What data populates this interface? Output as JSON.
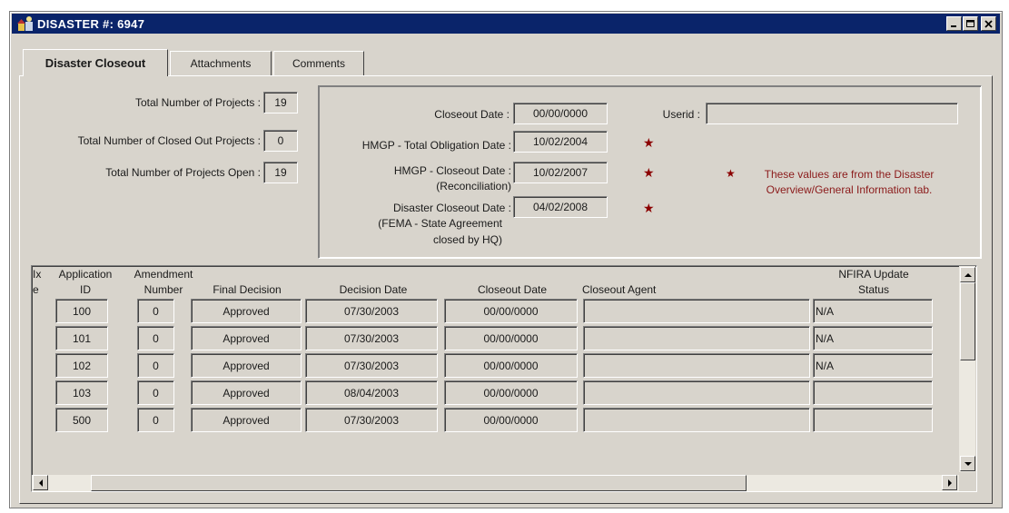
{
  "window": {
    "title": "DISASTER #: 6947"
  },
  "tabs": [
    {
      "label": "Disaster Closeout",
      "active": true
    },
    {
      "label": "Attachments",
      "active": false
    },
    {
      "label": "Comments",
      "active": false
    }
  ],
  "summary": {
    "total_projects_label": "Total Number of Projects :",
    "total_projects_value": "19",
    "closed_projects_label": "Total Number of Closed Out Projects :",
    "closed_projects_value": "0",
    "open_projects_label": "Total Number of Projects Open :",
    "open_projects_value": "19"
  },
  "dates": {
    "closeout_date_label": "Closeout Date :",
    "closeout_date_value": "00/00/0000",
    "userid_label": "Userid :",
    "userid_value": "",
    "hmgp_obligation_label": "HMGP - Total Obligation Date :",
    "hmgp_obligation_value": "10/02/2004",
    "hmgp_closeout_label_1": "HMGP - Closeout Date :",
    "hmgp_closeout_label_2": "(Reconciliation)",
    "hmgp_closeout_value": "10/02/2007",
    "disaster_closeout_label_1": "Disaster Closeout Date :",
    "disaster_closeout_label_2": "(FEMA - State Agreement",
    "disaster_closeout_label_3": "closed by HQ)",
    "disaster_closeout_value": "04/02/2008",
    "star_symbol": "★",
    "note_line_1": "These values are from the Disaster",
    "note_line_2": "Overview/General Information tab.",
    "note_color": "#8b1a1a"
  },
  "grid": {
    "headers": {
      "index_1": "Ix",
      "index_2": "e",
      "application_1": "Application",
      "application_2": "ID",
      "amendment_1": "Amendment",
      "amendment_2": "Number",
      "final_decision": "Final Decision",
      "decision_date": "Decision Date",
      "closeout_date": "Closeout Date",
      "closeout_agent": "Closeout Agent",
      "nfira_1": "NFIRA Update",
      "nfira_2": "Status"
    },
    "rows": [
      {
        "app_id": "100",
        "amendment": "0",
        "decision": "Approved",
        "decision_date": "07/30/2003",
        "closeout_date": "00/00/0000",
        "agent": "",
        "nfira": "N/A"
      },
      {
        "app_id": "101",
        "amendment": "0",
        "decision": "Approved",
        "decision_date": "07/30/2003",
        "closeout_date": "00/00/0000",
        "agent": "",
        "nfira": "N/A"
      },
      {
        "app_id": "102",
        "amendment": "0",
        "decision": "Approved",
        "decision_date": "07/30/2003",
        "closeout_date": "00/00/0000",
        "agent": "",
        "nfira": "N/A"
      },
      {
        "app_id": "103",
        "amendment": "0",
        "decision": "Approved",
        "decision_date": "08/04/2003",
        "closeout_date": "00/00/0000",
        "agent": "",
        "nfira": ""
      },
      {
        "app_id": "500",
        "amendment": "0",
        "decision": "Approved",
        "decision_date": "07/30/2003",
        "closeout_date": "00/00/0000",
        "agent": "",
        "nfira": ""
      }
    ]
  },
  "colors": {
    "titlebar": "#0a246a",
    "panel": "#d8d4cc",
    "star": "#8b0000"
  },
  "icons": {
    "window": "disaster-app-icon",
    "minimize": "minimize-icon",
    "maximize": "maximize-icon",
    "close": "close-icon"
  }
}
